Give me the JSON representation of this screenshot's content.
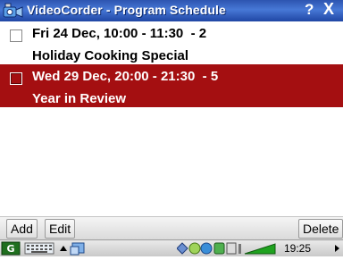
{
  "window": {
    "title": "VideoCorder - Program Schedule",
    "help": "?",
    "close": "X"
  },
  "schedule": [
    {
      "time": "Fri 24 Dec, 10:00 - 11:30  - 2",
      "program": "Holiday Cooking Special",
      "selected": false
    },
    {
      "time": "Wed 29 Dec, 20:00 - 21:30  - 5",
      "program": "Year in Review",
      "selected": true
    }
  ],
  "toolbar": {
    "add_label": "Add",
    "edit_label": "Edit",
    "delete_label": "Delete"
  },
  "taskbar": {
    "clock": "19:25"
  },
  "colors": {
    "titlebar": "#3561c2",
    "selection": "#a40f11"
  }
}
